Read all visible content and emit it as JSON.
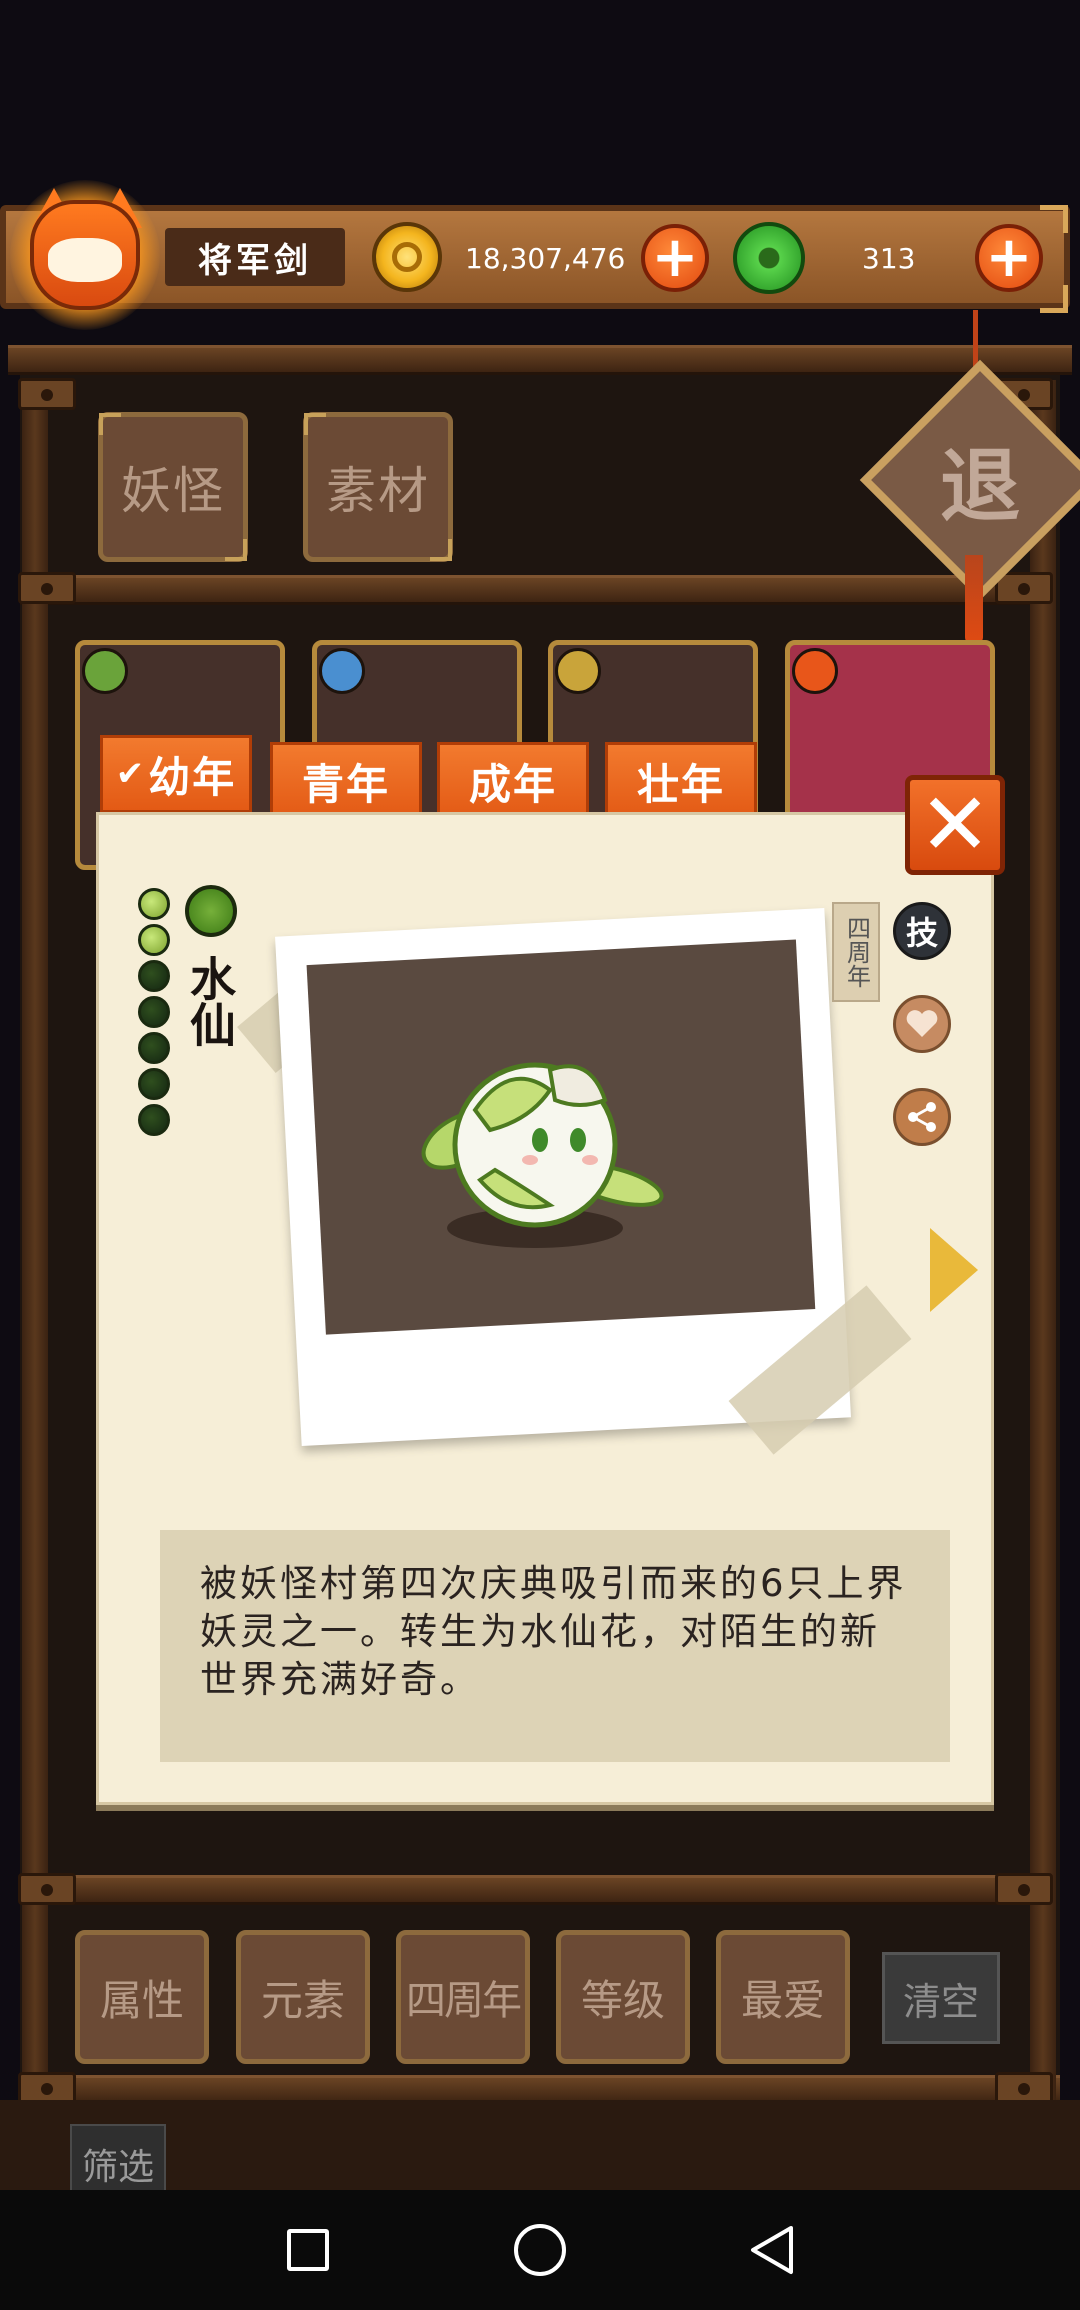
{
  "player": {
    "name": "将军剑"
  },
  "currency": {
    "gold": "18,307,476",
    "jade": "313",
    "gold_plus": "+",
    "jade_plus": "+"
  },
  "top_tabs": [
    "妖怪",
    "素材"
  ],
  "exit_label": "退",
  "age_tabs": [
    {
      "label": "幼年",
      "selected": true,
      "check": "✔"
    },
    {
      "label": "青年"
    },
    {
      "label": "成年"
    },
    {
      "label": "壮年"
    }
  ],
  "close_label": "✕",
  "character": {
    "name": "水仙",
    "level_filled": 2,
    "level_total": 7,
    "anniversary_tag": "四周年",
    "skill_label": "技",
    "description": "被妖怪村第四次庆典吸引而来的6只上界妖灵之一。转生为水仙花，对陌生的新世界充满好奇。"
  },
  "filters": [
    "属性",
    "元素",
    "四周年",
    "等级",
    "最爱"
  ],
  "clear_label": "清空",
  "screen_label": "筛选",
  "colors": {
    "accent_orange": "#e35a15",
    "wood_dark": "#3e2412",
    "paper": "#f6eed7",
    "leaf_green": "#76b03a"
  }
}
